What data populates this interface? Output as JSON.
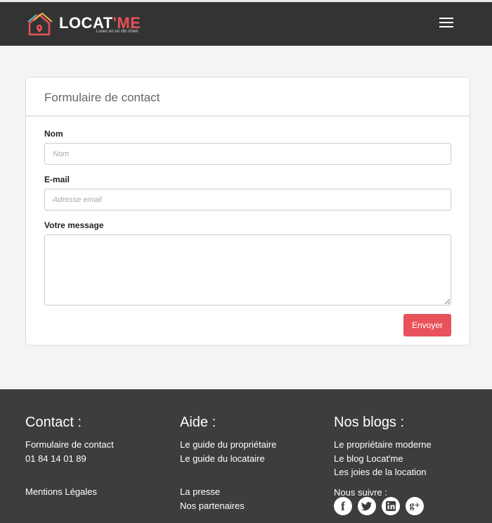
{
  "header": {
    "logo_text_main": "LOCAT",
    "logo_text_accent": "'ME",
    "logo_tagline": "Louez en un clin d'oeil",
    "brand_color": "#e8525a"
  },
  "form": {
    "title": "Formulaire de contact",
    "name_label": "Nom",
    "name_placeholder": "Nom",
    "email_label": "E-mail",
    "email_placeholder": "Adresse email",
    "message_label": "Votre message",
    "submit_label": "Envoyer"
  },
  "footer": {
    "contact": {
      "heading": "Contact :",
      "links": [
        "Formulaire de contact",
        "01 84 14 01 89"
      ],
      "bottom_links": [
        "Mentions Légales"
      ]
    },
    "aide": {
      "heading": "Aide :",
      "links": [
        "Le guide du propriétaire",
        "Le guide du locataire"
      ],
      "bottom_links": [
        "La presse",
        "Nos partenaires"
      ]
    },
    "blogs": {
      "heading": "Nos blogs :",
      "links": [
        "Le propriétaire moderne",
        "Le blog Locat'me",
        "Les joies de la location"
      ],
      "follow_label": "Nous suivre :"
    },
    "socials": [
      {
        "icon": "facebook-icon",
        "glyph": "f"
      },
      {
        "icon": "twitter-icon",
        "glyph": "t"
      },
      {
        "icon": "linkedin-icon",
        "glyph": "in"
      },
      {
        "icon": "googleplus-icon",
        "glyph": "g+"
      }
    ]
  }
}
